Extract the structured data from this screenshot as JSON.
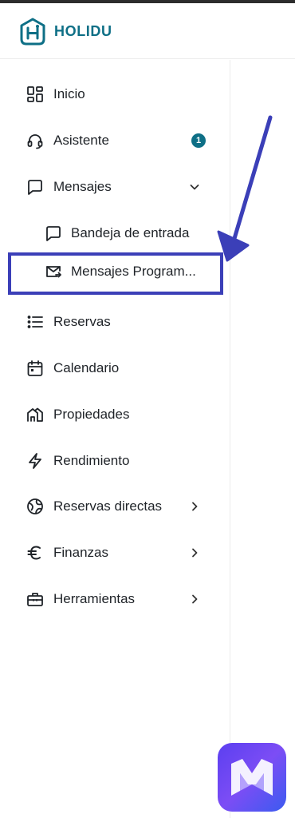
{
  "brand": {
    "name": "HOLIDU",
    "color": "#0e6f86"
  },
  "nav": {
    "inicio": "Inicio",
    "asistente": "Asistente",
    "asistente_badge": "1",
    "mensajes": "Mensajes",
    "bandeja": "Bandeja de entrada",
    "programados": "Mensajes Program...",
    "reservas": "Reservas",
    "calendario": "Calendario",
    "propiedades": "Propiedades",
    "rendimiento": "Rendimiento",
    "reservas_directas": "Reservas directas",
    "finanzas": "Finanzas",
    "herramientas": "Herramientas"
  },
  "icons": {
    "inicio": "dashboard-grid-icon",
    "asistente": "headset-icon",
    "mensajes": "chat-bubble-icon",
    "bandeja": "chat-bubble-icon",
    "programados": "scheduled-mail-icon",
    "reservas": "list-icon",
    "calendario": "calendar-icon",
    "propiedades": "houses-icon",
    "rendimiento": "lightning-icon",
    "reservas_directas": "globe-icon",
    "finanzas": "euro-icon",
    "herramientas": "toolbox-icon"
  },
  "annotation": {
    "color": "#3b3fb8"
  },
  "fab": {
    "gradient_start": "#5b3ff0",
    "gradient_end": "#3b5bf0"
  }
}
